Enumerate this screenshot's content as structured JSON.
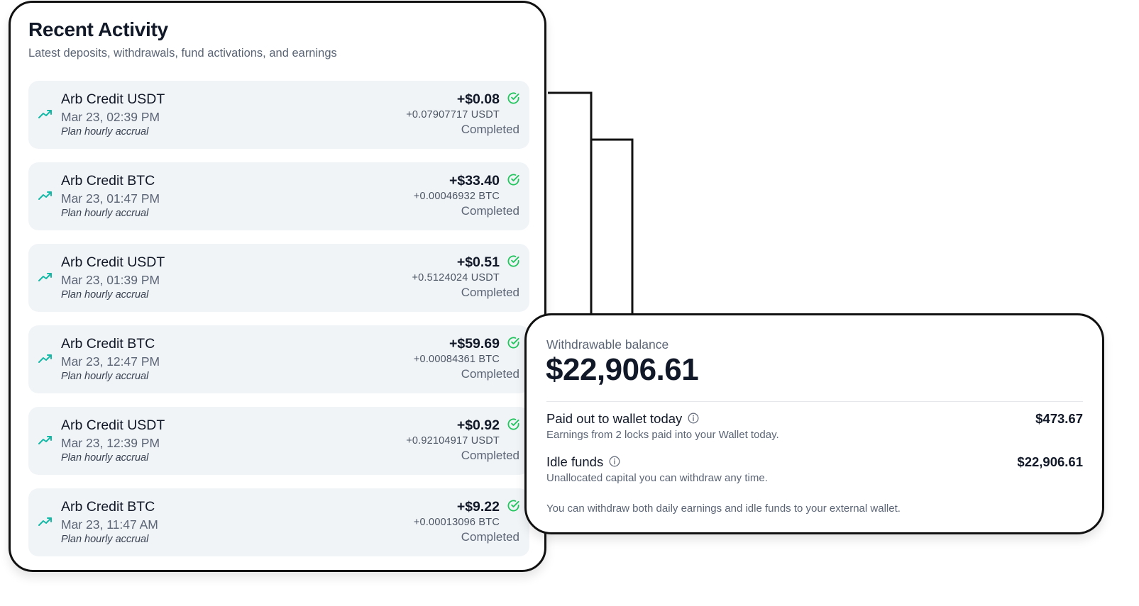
{
  "activity": {
    "title": "Recent Activity",
    "subtitle": "Latest deposits, withdrawals, fund activations, and earnings",
    "rows": [
      {
        "title": "Arb Credit USDT",
        "date": "Mar 23, 02:39 PM",
        "note": "Plan hourly accrual",
        "amount": "+$0.08",
        "crypto": "+0.07907717 USDT",
        "status": "Completed"
      },
      {
        "title": "Arb Credit BTC",
        "date": "Mar 23, 01:47 PM",
        "note": "Plan hourly accrual",
        "amount": "+$33.40",
        "crypto": "+0.00046932 BTC",
        "status": "Completed"
      },
      {
        "title": "Arb Credit USDT",
        "date": "Mar 23, 01:39 PM",
        "note": "Plan hourly accrual",
        "amount": "+$0.51",
        "crypto": "+0.5124024 USDT",
        "status": "Completed"
      },
      {
        "title": "Arb Credit BTC",
        "date": "Mar 23, 12:47 PM",
        "note": "Plan hourly accrual",
        "amount": "+$59.69",
        "crypto": "+0.00084361 BTC",
        "status": "Completed"
      },
      {
        "title": "Arb Credit USDT",
        "date": "Mar 23, 12:39 PM",
        "note": "Plan hourly accrual",
        "amount": "+$0.92",
        "crypto": "+0.92104917 USDT",
        "status": "Completed"
      },
      {
        "title": "Arb Credit BTC",
        "date": "Mar 23, 11:47 AM",
        "note": "Plan hourly accrual",
        "amount": "+$9.22",
        "crypto": "+0.00013096 BTC",
        "status": "Completed"
      }
    ],
    "row_icon": "trending-up-icon",
    "status_icon": "check-circle-icon"
  },
  "balance": {
    "label": "Withdrawable balance",
    "value": "$22,906.61",
    "items": [
      {
        "title": "Paid out to wallet today",
        "value": "$473.67",
        "description": "Earnings from 2 locks paid into your Wallet today.",
        "icon": "info-icon"
      },
      {
        "title": "Idle funds",
        "value": "$22,906.61",
        "description": "Unallocated capital you can withdraw any time.",
        "icon": "info-icon"
      }
    ],
    "footnote": "You can withdraw both daily earnings and idle funds to your external wallet."
  },
  "colors": {
    "accent_teal": "#14b8a6",
    "success_green": "#22c55e",
    "row_bg": "#f1f4f7",
    "muted_text": "#5b6575"
  }
}
